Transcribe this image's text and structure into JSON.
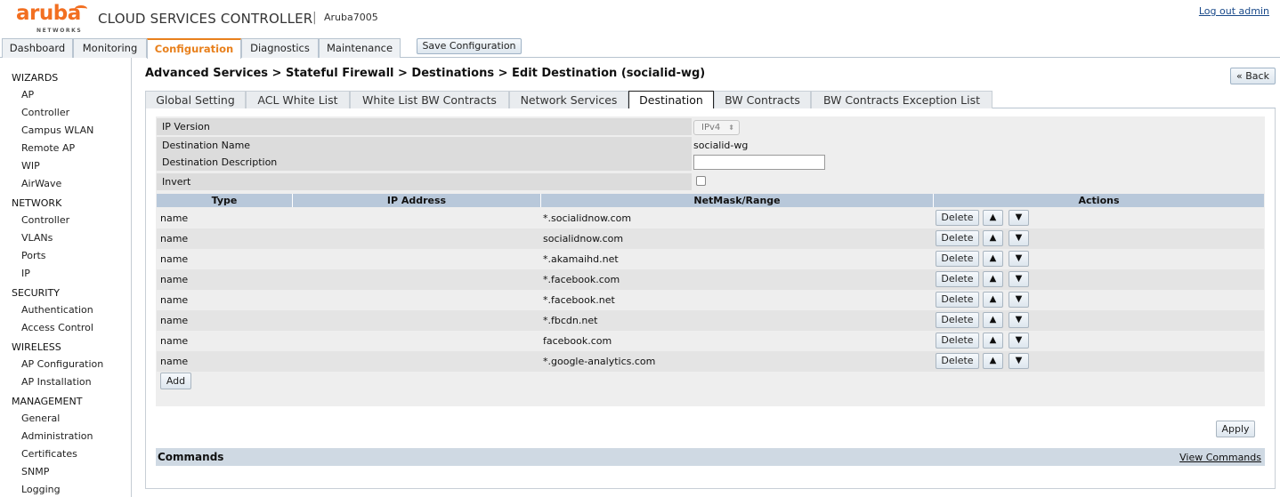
{
  "header": {
    "logo_text": "aruba",
    "logo_sub": "NETWORKS",
    "app_title": "CLOUD SERVICES CONTROLLER",
    "separator": "|",
    "hostname": "Aruba7005",
    "logout_label": "Log out admin"
  },
  "topnav": {
    "tabs": [
      {
        "label": "Dashboard"
      },
      {
        "label": "Monitoring"
      },
      {
        "label": "Configuration",
        "active": true
      },
      {
        "label": "Diagnostics"
      },
      {
        "label": "Maintenance"
      }
    ],
    "save_label": "Save Configuration"
  },
  "sidebar": {
    "sections": [
      {
        "title": "WIZARDS",
        "items": [
          "AP",
          "Controller",
          "Campus WLAN",
          "Remote AP",
          "WIP",
          "AirWave"
        ]
      },
      {
        "title": "NETWORK",
        "items": [
          "Controller",
          "VLANs",
          "Ports",
          "IP"
        ]
      },
      {
        "title": "SECURITY",
        "items": [
          "Authentication",
          "Access Control"
        ]
      },
      {
        "title": "WIRELESS",
        "items": [
          "AP Configuration",
          "AP Installation"
        ]
      },
      {
        "title": "MANAGEMENT",
        "items": [
          "General",
          "Administration",
          "Certificates",
          "SNMP",
          "Logging"
        ]
      }
    ]
  },
  "main": {
    "breadcrumb": "Advanced Services > Stateful Firewall > Destinations > Edit Destination (socialid-wg)",
    "back_label": "« Back",
    "subtabs": [
      {
        "label": "Global Setting"
      },
      {
        "label": "ACL White List"
      },
      {
        "label": "White List BW Contracts"
      },
      {
        "label": "Network Services"
      },
      {
        "label": "Destination",
        "active": true
      },
      {
        "label": "BW Contracts"
      },
      {
        "label": "BW Contracts Exception List"
      }
    ],
    "form": {
      "ip_version_label": "IP Version",
      "ip_version_value": "IPv4",
      "dest_name_label": "Destination Name",
      "dest_name_value": "socialid-wg",
      "dest_desc_label": "Destination Description",
      "dest_desc_value": "",
      "invert_label": "Invert",
      "invert_checked": false
    },
    "table": {
      "headers": {
        "type": "Type",
        "ip": "IP Address",
        "mask": "NetMask/Range",
        "actions": "Actions"
      },
      "rows": [
        {
          "type": "name",
          "ip": "",
          "mask": "*.socialidnow.com"
        },
        {
          "type": "name",
          "ip": "",
          "mask": "socialidnow.com"
        },
        {
          "type": "name",
          "ip": "",
          "mask": "*.akamaihd.net"
        },
        {
          "type": "name",
          "ip": "",
          "mask": "*.facebook.com"
        },
        {
          "type": "name",
          "ip": "",
          "mask": "*.facebook.net"
        },
        {
          "type": "name",
          "ip": "",
          "mask": "*.fbcdn.net"
        },
        {
          "type": "name",
          "ip": "",
          "mask": "facebook.com"
        },
        {
          "type": "name",
          "ip": "",
          "mask": "*.google-analytics.com"
        }
      ],
      "delete_label": "Delete",
      "up_icon": "▲",
      "down_icon": "▼"
    },
    "add_label": "Add",
    "apply_label": "Apply",
    "commands": {
      "title": "Commands",
      "view_label": "View Commands"
    }
  },
  "colors": {
    "brand_orange": "#f26f21",
    "active_tab": "#e8801c",
    "table_header": "#b8c8da",
    "commands_bar": "#cfd9e3"
  }
}
